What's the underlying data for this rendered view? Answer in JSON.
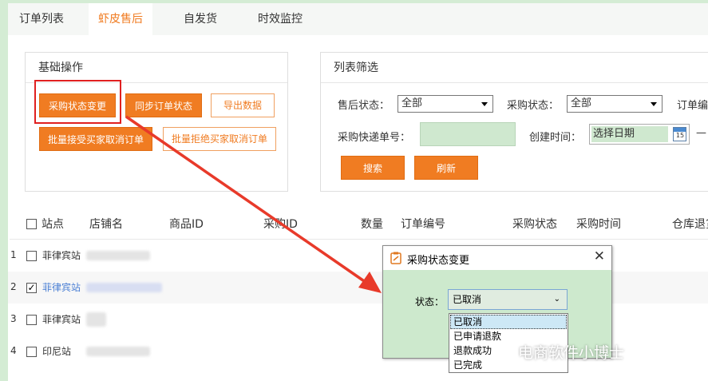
{
  "tabs": [
    "订单列表",
    "虾皮售后",
    "自发货",
    "时效监控"
  ],
  "basic_ops": {
    "title": "基础操作",
    "buttons": {
      "change_purchase_status": "采购状态变更",
      "sync_order_status": "同步订单状态",
      "export_data": "导出数据",
      "batch_accept_cancel": "批量接受买家取消订单",
      "batch_reject_cancel": "批量拒绝买家取消订单"
    }
  },
  "filter": {
    "title": "列表筛选",
    "after_sale_status_label": "售后状态：",
    "after_sale_status_value": "全部",
    "purchase_status_label": "采购状态：",
    "purchase_status_value": "全部",
    "order_no_label": "订单编",
    "tracking_label": "采购快递单号：",
    "tracking_value": "",
    "created_time_label": "创建时间：",
    "date_placeholder": "选择日期",
    "calendar_day": "15",
    "range_dash": "—",
    "search_button": "搜索",
    "refresh_button": "刷新"
  },
  "table": {
    "headers": [
      "站点",
      "店铺名",
      "商品ID",
      "采购ID",
      "数量",
      "订单编号",
      "采购状态",
      "采购时间",
      "仓库退货"
    ],
    "rows": [
      {
        "num": "1",
        "site": "菲律宾站",
        "checked": false
      },
      {
        "num": "2",
        "site": "菲律宾站",
        "checked": true
      },
      {
        "num": "3",
        "site": "菲律宾站",
        "checked": false
      },
      {
        "num": "4",
        "site": "印尼站",
        "checked": false
      }
    ]
  },
  "dialog": {
    "title": "采购状态变更",
    "status_label": "状态：",
    "status_value": "已取消",
    "options": [
      "已取消",
      "已申请退款",
      "退款成功",
      "已完成"
    ]
  },
  "watermark": "电商软件小博士",
  "colors": {
    "accent": "#f07c22",
    "highlight_box": "#e02020",
    "arrow": "#e83a2a",
    "background": "#d4ecd4",
    "dialog_bg": "#cde9cd"
  }
}
